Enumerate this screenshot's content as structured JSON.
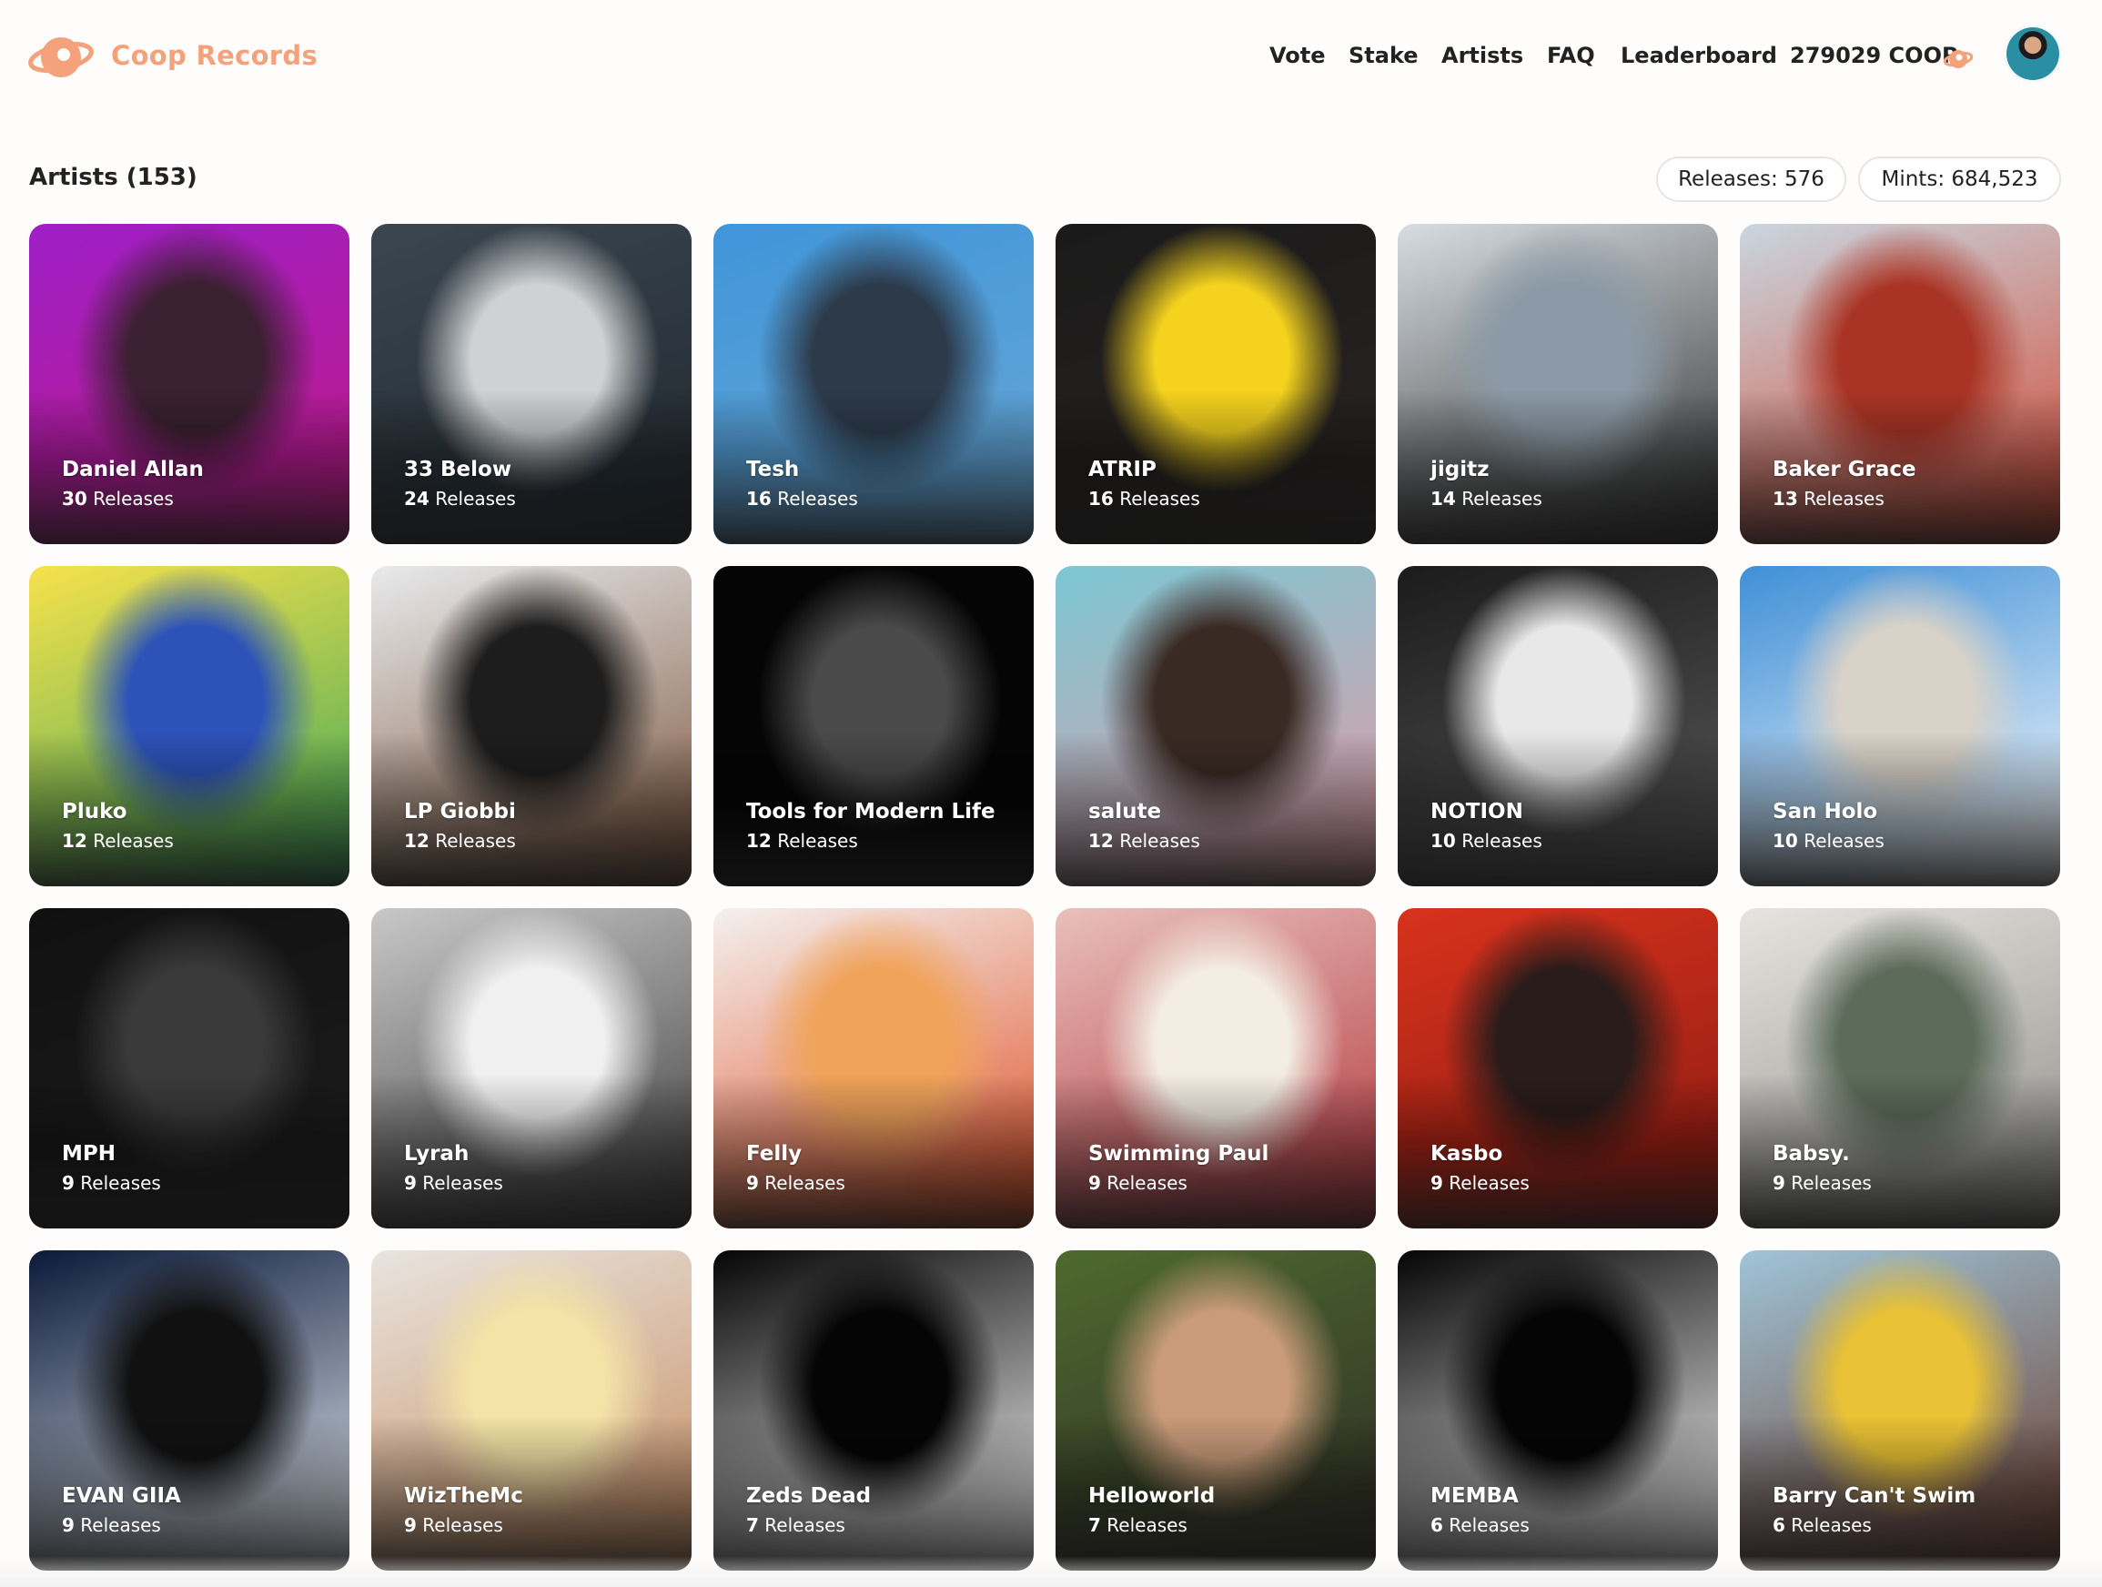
{
  "header": {
    "brand": "Coop Records",
    "nav": [
      "Vote",
      "Stake",
      "Artists",
      "FAQ",
      "Leaderboard"
    ],
    "balance": "279029 COOP",
    "accent": "#f3a27c"
  },
  "page": {
    "title": "Artists (153)",
    "releases_pill": "Releases: 576",
    "mints_pill": "Mints: 684,523"
  },
  "artists": [
    {
      "name": "Daniel Allan",
      "count": "30",
      "suffix": "Releases",
      "colors": [
        "#9d1fc7",
        "#c21a85",
        "#3a2030"
      ]
    },
    {
      "name": "33 Below",
      "count": "24",
      "suffix": "Releases",
      "colors": [
        "#3b4650",
        "#1e262c",
        "#cfd1d2"
      ]
    },
    {
      "name": "Tesh",
      "count": "16",
      "suffix": "Releases",
      "colors": [
        "#3f95d9",
        "#6aa8d6",
        "#2c3a4a"
      ]
    },
    {
      "name": "ATRIP",
      "count": "16",
      "suffix": "Releases",
      "colors": [
        "#1a1a1a",
        "#2a2422",
        "#f4d21e"
      ]
    },
    {
      "name": "jigitz",
      "count": "14",
      "suffix": "Releases",
      "colors": [
        "#d7dde2",
        "#2b2b2b",
        "#8b9aa6"
      ]
    },
    {
      "name": "Baker Grace",
      "count": "13",
      "suffix": "Releases",
      "colors": [
        "#c9d6e0",
        "#d2452f",
        "#a93425"
      ]
    },
    {
      "name": "Pluko",
      "count": "12",
      "suffix": "Releases",
      "colors": [
        "#f7e14b",
        "#3ba65a",
        "#2d52b8"
      ]
    },
    {
      "name": "LP Giobbi",
      "count": "12",
      "suffix": "Releases",
      "colors": [
        "#e8eaec",
        "#7a5238",
        "#1d1d1d"
      ]
    },
    {
      "name": "Tools for Modern Life",
      "count": "12",
      "suffix": "Releases",
      "colors": [
        "#050505",
        "#050505",
        "#4a4a4a"
      ]
    },
    {
      "name": "salute",
      "count": "12",
      "suffix": "Releases",
      "colors": [
        "#7cc7d4",
        "#e59aa6",
        "#3a2a24"
      ]
    },
    {
      "name": "NOTION",
      "count": "10",
      "suffix": "Releases",
      "colors": [
        "#1b1b1b",
        "#5a5a5a",
        "#e8e8e8"
      ]
    },
    {
      "name": "San Holo",
      "count": "10",
      "suffix": "Releases",
      "colors": [
        "#3f8fd6",
        "#ffffff",
        "#d9d2c8"
      ]
    },
    {
      "name": "MPH",
      "count": "9",
      "suffix": "Releases",
      "colors": [
        "#101010",
        "#1e1e1e",
        "#3a3a3a"
      ]
    },
    {
      "name": "Lyrah",
      "count": "9",
      "suffix": "Releases",
      "colors": [
        "#c8c8c8",
        "#3b3b3b",
        "#f0f0f0"
      ]
    },
    {
      "name": "Felly",
      "count": "9",
      "suffix": "Releases",
      "colors": [
        "#f4f1ef",
        "#e04a1e",
        "#f0a35a"
      ]
    },
    {
      "name": "Swimming Paul",
      "count": "9",
      "suffix": "Releases",
      "colors": [
        "#e9c0bb",
        "#b0323a",
        "#f3ede3"
      ]
    },
    {
      "name": "Kasbo",
      "count": "9",
      "suffix": "Releases",
      "colors": [
        "#d8321c",
        "#8a1a12",
        "#2a1c1a"
      ]
    },
    {
      "name": "Babsy.",
      "count": "9",
      "suffix": "Releases",
      "colors": [
        "#e7e4df",
        "#8a8a86",
        "#5c6b5a"
      ]
    },
    {
      "name": "EVAN GIIA",
      "count": "9",
      "suffix": "Releases",
      "colors": [
        "#0b1a3a",
        "#e8eef5",
        "#111111"
      ]
    },
    {
      "name": "WizTheMc",
      "count": "9",
      "suffix": "Releases",
      "colors": [
        "#e8e4df",
        "#c68a5c",
        "#f4e3a6"
      ]
    },
    {
      "name": "Zeds Dead",
      "count": "7",
      "suffix": "Releases",
      "colors": [
        "#050505",
        "#ffffff",
        "#050505"
      ]
    },
    {
      "name": "Helloworld",
      "count": "7",
      "suffix": "Releases",
      "colors": [
        "#4e6a2f",
        "#2d2a24",
        "#c99b7a"
      ]
    },
    {
      "name": "MEMBA",
      "count": "6",
      "suffix": "Releases",
      "colors": [
        "#050505",
        "#ffffff",
        "#050505"
      ]
    },
    {
      "name": "Barry Can't Swim",
      "count": "6",
      "suffix": "Releases",
      "colors": [
        "#9fc4d8",
        "#6b3a2a",
        "#e9c235"
      ]
    }
  ]
}
